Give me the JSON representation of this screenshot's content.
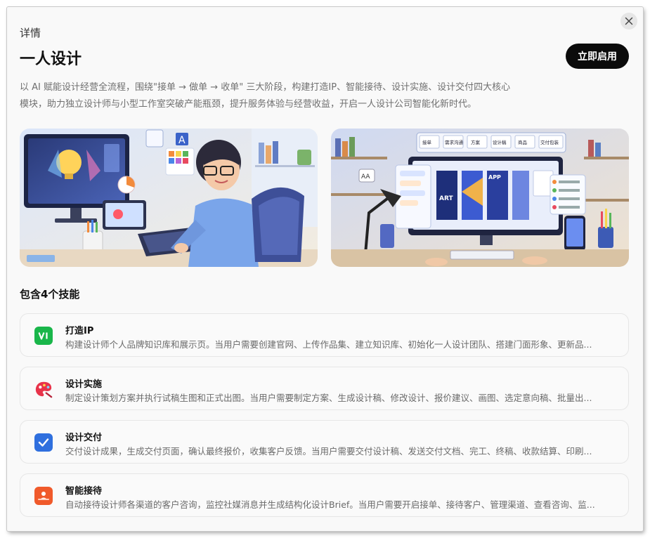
{
  "header": {
    "breadcrumb": "详情",
    "title": "一人设计",
    "primary_action": "立即启用",
    "close_icon": "close-icon"
  },
  "description": [
    "以 AI 赋能设计经营全流程，围绕\"接单 → 做单 → 收单\" 三大阶段，构建打造IP、智能接待、设计实施、设计交付四大核心",
    "模块，助力独立设计师与小型工作室突破产能瓶颈，提升服务体验与经营收益，开启一人设计公司智能化新时代。"
  ],
  "banners": {
    "right_screen_tabs": [
      "接单",
      "需求沟通",
      "方案",
      "设计稿",
      "商品",
      "交付包装"
    ]
  },
  "skills_section": {
    "title": "包含4个技能",
    "items": [
      {
        "name": "打造IP",
        "icon": "vi-icon",
        "color": "#19b64a",
        "description": "构建设计师个人品牌知识库和展示页。当用户需要创建官网、上传作品集、建立知识库、初始化一人设计团队、搭建门面形象、更新品..."
      },
      {
        "name": "设计实施",
        "icon": "palette-icon",
        "color": "#e8334a",
        "description": "制定设计策划方案并执行试稿生图和正式出图。当用户需要制定方案、生成设计稿、修改设计、报价建议、画图、选定意向稿、批量出..."
      },
      {
        "name": "设计交付",
        "icon": "checkbox-icon",
        "color": "#2f6fde",
        "description": "交付设计成果，生成交付页面，确认最终报价，收集客户反馈。当用户需要交付设计稿、发送交付文档、完工、终稿、收款结算、印刷..."
      },
      {
        "name": "智能接待",
        "icon": "reception-icon",
        "color": "#f05a2b",
        "description": "自动接待设计师各渠道的客户咨询，监控社媒消息并生成结构化设计Brief。当用户需要开启接单、接待客户、管理渠道、查看咨询、监..."
      }
    ]
  }
}
